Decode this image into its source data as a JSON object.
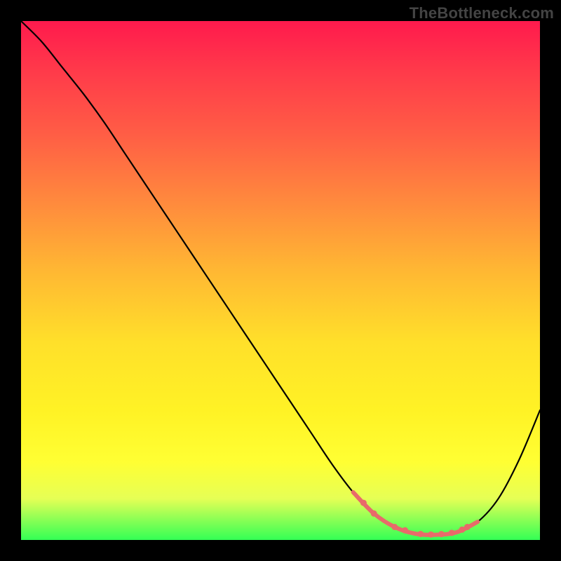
{
  "watermark": "TheBottleneck.com",
  "colors": {
    "curve": "#000000",
    "accent": "#e86a6a",
    "background_top": "#ff1a4d",
    "background_bottom": "#33ff55",
    "frame": "#000000"
  },
  "chart_data": {
    "type": "line",
    "title": "",
    "xlabel": "",
    "ylabel": "",
    "xlim": [
      0,
      100
    ],
    "ylim": [
      0,
      100
    ],
    "grid": false,
    "legend": false,
    "series": [
      {
        "name": "bottleneck-curve",
        "x": [
          0,
          4,
          8,
          12,
          16,
          20,
          24,
          28,
          32,
          36,
          40,
          44,
          48,
          52,
          56,
          60,
          64,
          68,
          72,
          76,
          80,
          84,
          88,
          92,
          96,
          100
        ],
        "y": [
          100,
          96,
          91,
          86,
          80.5,
          74.5,
          68.5,
          62.5,
          56.5,
          50.5,
          44.5,
          38.5,
          32.5,
          26.5,
          20.5,
          14.5,
          9.2,
          5.1,
          2.5,
          1.2,
          1.0,
          1.5,
          3.5,
          8.0,
          15.5,
          25.0
        ]
      }
    ],
    "accent_region": {
      "description": "lowest-bottleneck segment highlighted along the curve floor",
      "x_range": [
        66,
        86
      ],
      "y_approx": 1.2,
      "dot_x": [
        66,
        68,
        72,
        74,
        77,
        79,
        81,
        83,
        85,
        86
      ]
    }
  }
}
